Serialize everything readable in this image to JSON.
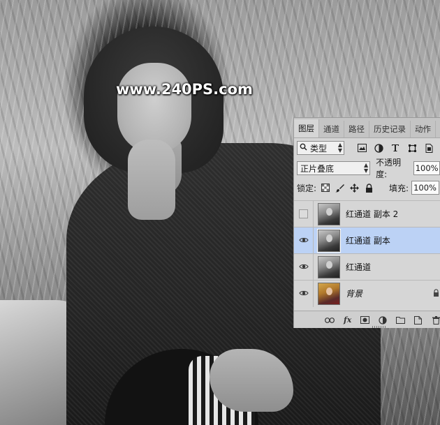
{
  "watermark": "www.240PS.com",
  "panel": {
    "tabs": [
      {
        "label": "图层",
        "active": true
      },
      {
        "label": "通道",
        "active": false
      },
      {
        "label": "路径",
        "active": false
      },
      {
        "label": "历史记录",
        "active": false
      },
      {
        "label": "动作",
        "active": false
      }
    ],
    "filter": {
      "kind_label": "类型",
      "icons": [
        "image-filter-icon",
        "adjustment-filter-icon",
        "type-filter-icon",
        "shape-filter-icon",
        "smart-object-filter-icon"
      ]
    },
    "blend": {
      "mode": "正片叠底",
      "opacity_label": "不透明度:",
      "opacity_value": "100%"
    },
    "lock": {
      "label": "锁定:",
      "fill_label": "填充:",
      "fill_value": "100%"
    },
    "layers": [
      {
        "name": "红通道 副本 2",
        "visible": false,
        "selected": false,
        "thumb": "bw"
      },
      {
        "name": "红通道 副本",
        "visible": true,
        "selected": true,
        "thumb": "bw"
      },
      {
        "name": "红通道",
        "visible": true,
        "selected": false,
        "thumb": "bw"
      },
      {
        "name": "背景",
        "visible": true,
        "selected": false,
        "thumb": "color",
        "locked": true
      }
    ],
    "footer": {
      "fx_label": "fx"
    }
  },
  "colors": {
    "panel_bg": "#d6d6d6",
    "selected_row": "#bcd2f5"
  }
}
